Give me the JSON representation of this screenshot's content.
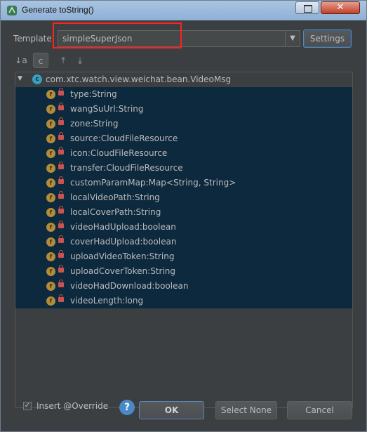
{
  "window": {
    "title": "Generate toString()",
    "close_glyph": "✕"
  },
  "template": {
    "label": "Template",
    "value": "simpleSuperJson",
    "dropdown_glyph": "▼"
  },
  "settings_label": "Settings",
  "toolbar": [
    {
      "name": "sort-alpha-icon",
      "glyph": "↓a"
    },
    {
      "name": "show-classes-icon",
      "glyph": "c"
    },
    {
      "name": "expand-all-icon",
      "glyph": "⤒"
    },
    {
      "name": "collapse-all-icon",
      "glyph": "⤓"
    }
  ],
  "tree": {
    "root": {
      "icon": "c",
      "label": "com.xtc.watch.view.weichat.bean.VideoMsg"
    },
    "fields": [
      "type:String",
      "wangSuUrl:String",
      "zone:String",
      "source:CloudFileResource",
      "icon:CloudFileResource",
      "transfer:CloudFileResource",
      "customParamMap:Map<String, String>",
      "localVideoPath:String",
      "localCoverPath:String",
      "videoHadUpload:boolean",
      "coverHadUpload:boolean",
      "uploadVideoToken:String",
      "uploadCoverToken:String",
      "videoHadDownload:boolean",
      "videoLength:long"
    ],
    "field_icon": "f"
  },
  "bottom": {
    "insert_override_label": "Insert @Override",
    "insert_override_checked": true,
    "help_glyph": "?",
    "ok_label": "OK",
    "select_none_label": "Select None",
    "cancel_label": "Cancel"
  },
  "colors": {
    "selection": "#0d293e",
    "highlight": "#ff2020",
    "field_icon": "#b28c3a",
    "class_icon": "#3b9dc1"
  }
}
